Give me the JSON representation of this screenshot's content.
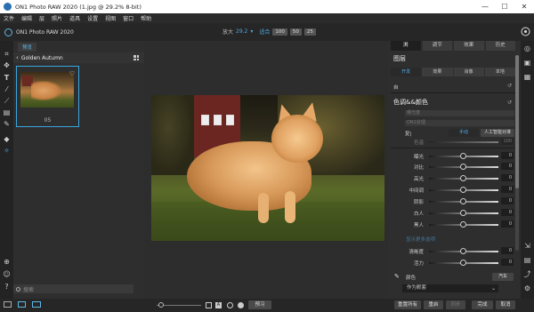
{
  "window": {
    "title": "ON1 Photo RAW 2020 (1.jpg @ 29.2% 8-bit)",
    "minimize": "—",
    "maximize": "☐",
    "close": "✕"
  },
  "menu": [
    "文件",
    "编辑",
    "层",
    "照片",
    "道具",
    "设置",
    "视图",
    "窗口",
    "帮助"
  ],
  "toolbar": {
    "app_name": "ON1 Photo RAW 2020",
    "zoom_label": "放大",
    "zoom_value": "29.2",
    "fit_label": "适合",
    "zoom_presets": [
      "100",
      "50",
      "25"
    ]
  },
  "browser": {
    "tab_label": "预览",
    "folder_name": "Golden Autumn",
    "thumbnail_label": "05",
    "search_placeholder": "搜索"
  },
  "canvas": {
    "compare_label": "预习"
  },
  "right_panel": {
    "tabs": [
      "浏",
      "调节",
      "效果",
      "历史"
    ],
    "layers_title": "图层",
    "subtabs": [
      "开发",
      "效果",
      "肖像",
      "本地"
    ],
    "auto_label": "自",
    "tone_title": "色调&&颜色",
    "dim_field_1": "曝光度",
    "dim_field_2": "ON1处理",
    "mode_label": "复|",
    "mode_btn_1": "手动",
    "mode_btn_2": "人工智能对准",
    "dim_slider_label": "色温",
    "dim_slider_value": "100",
    "sliders": [
      {
        "label": "曝光",
        "value": "0"
      },
      {
        "label": "对比",
        "value": "0"
      },
      {
        "label": "高光",
        "value": "0"
      },
      {
        "label": "中间调",
        "value": "0"
      },
      {
        "label": "阴影",
        "value": "0"
      },
      {
        "label": "白人",
        "value": "0"
      },
      {
        "label": "黑人",
        "value": "0"
      }
    ],
    "more_label": "显示更多选项",
    "sliders2": [
      {
        "label": "清晰度",
        "value": "0"
      },
      {
        "label": "活力",
        "value": "0"
      }
    ],
    "color_label": "颜色",
    "color_btn": "汽车",
    "color_mode": "作为默套"
  },
  "bottom_right": {
    "buttons": [
      "重置所有",
      "重启",
      "同步",
      "完成",
      "取消"
    ]
  },
  "colors": {
    "accent": "#4fa8e0",
    "panel": "#2e2e2e",
    "thumb_border": "#3aa6e0"
  }
}
